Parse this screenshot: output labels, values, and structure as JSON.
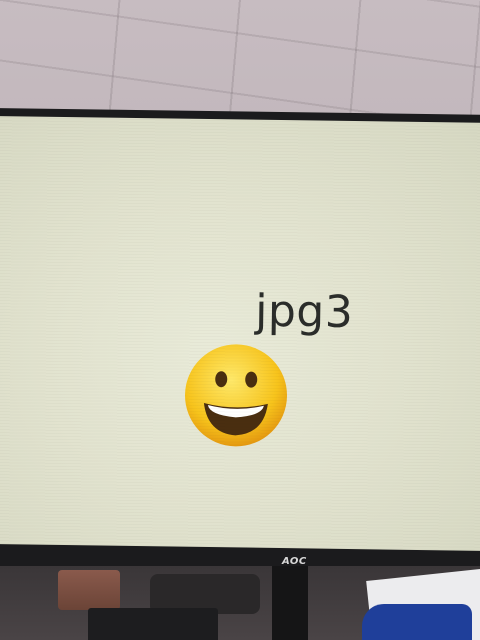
{
  "screen": {
    "label": "jpg3",
    "emoji": "grinning-face"
  },
  "monitor": {
    "brand": "AOC"
  }
}
